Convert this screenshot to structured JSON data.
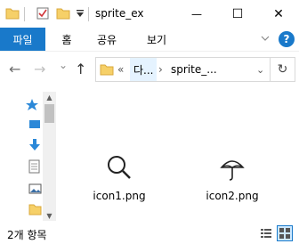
{
  "window": {
    "title": "sprite_ex",
    "controls": {
      "minimize": "—",
      "maximize": "☐",
      "close": "✕"
    }
  },
  "ribbon": {
    "tabs": [
      {
        "label": "파일",
        "active": true
      },
      {
        "label": "홈"
      },
      {
        "label": "공유"
      },
      {
        "label": "보기"
      }
    ],
    "help": "?"
  },
  "nav": {
    "back": "←",
    "forward": "→",
    "recent": "⌄",
    "up": "↑"
  },
  "address": {
    "overflow": "«",
    "segment1": "다...",
    "separator": "›",
    "segment2": "sprite_...",
    "dropdown": "⌄",
    "refresh": "↻"
  },
  "files": [
    {
      "name": "icon1.png",
      "icon": "magnifier-icon"
    },
    {
      "name": "icon2.png",
      "icon": "umbrella-icon"
    }
  ],
  "status": {
    "item_count": "2개 항목"
  },
  "colors": {
    "accent": "#1979ca",
    "selection": "#cce8ff"
  }
}
